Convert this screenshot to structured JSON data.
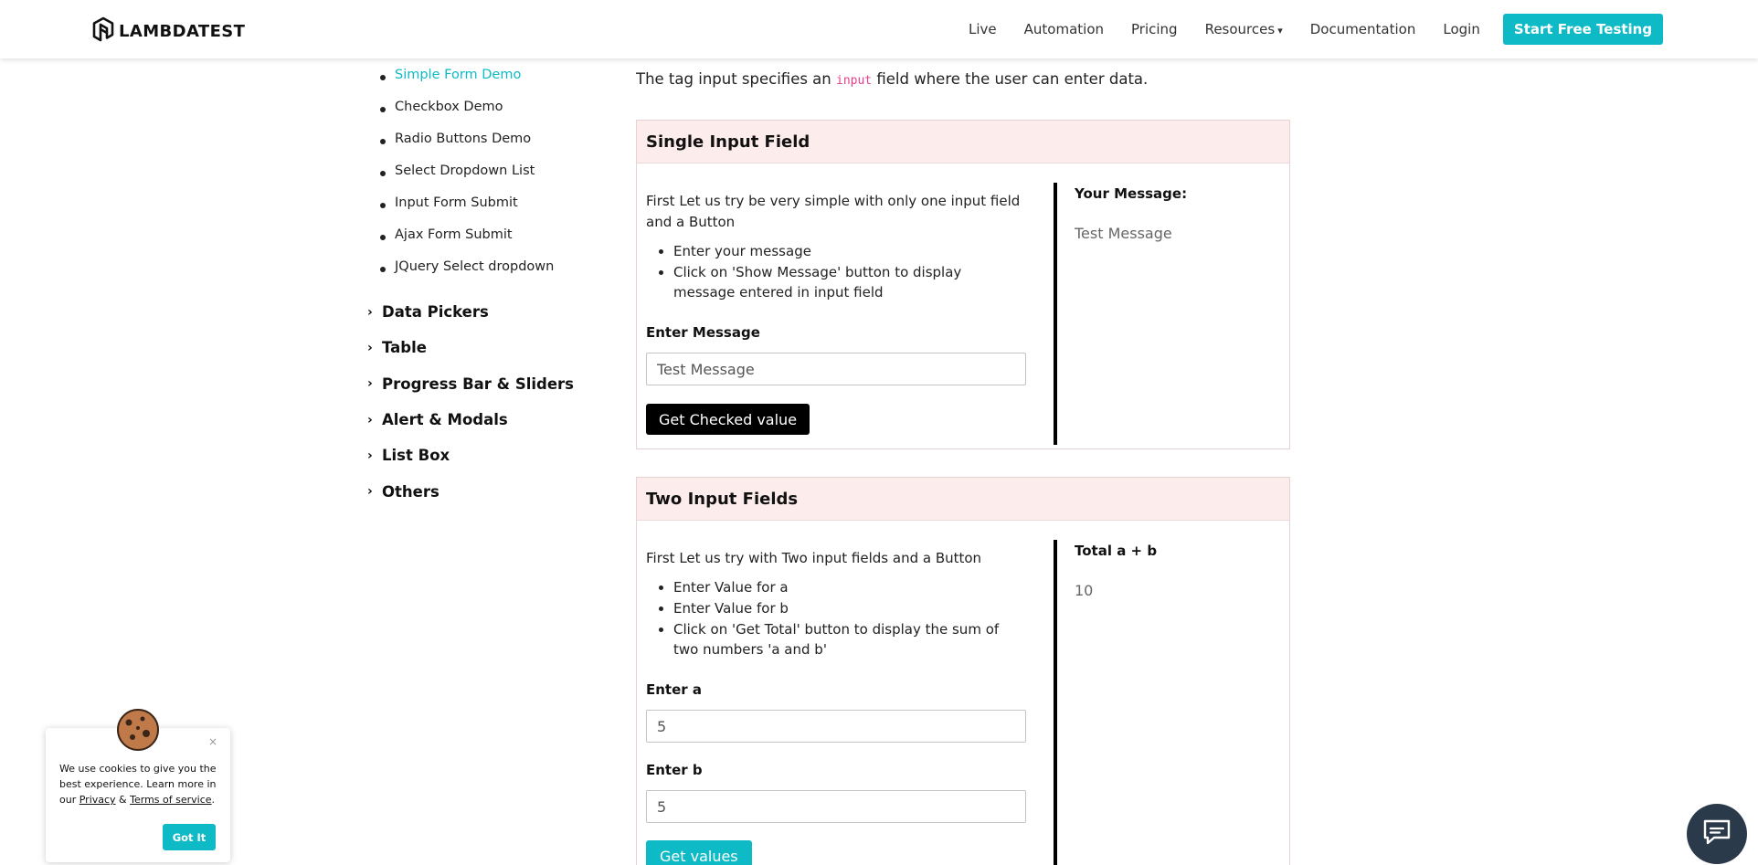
{
  "header": {
    "logo_text": "LAMBDATEST",
    "nav": [
      {
        "label": "Live"
      },
      {
        "label": "Automation"
      },
      {
        "label": "Pricing"
      },
      {
        "label": "Resources"
      },
      {
        "label": "Documentation"
      },
      {
        "label": "Login"
      }
    ],
    "cta_label": "Start Free Testing"
  },
  "sidebar": {
    "sub_items": [
      {
        "label": "Simple Form Demo",
        "active": true
      },
      {
        "label": "Checkbox Demo"
      },
      {
        "label": "Radio Buttons Demo"
      },
      {
        "label": "Select Dropdown List"
      },
      {
        "label": "Input Form Submit"
      },
      {
        "label": "Ajax Form Submit"
      },
      {
        "label": "JQuery Select dropdown"
      }
    ],
    "categories": [
      {
        "label": "Data Pickers"
      },
      {
        "label": "Table"
      },
      {
        "label": "Progress Bar & Sliders"
      },
      {
        "label": "Alert & Modals"
      },
      {
        "label": "List Box"
      },
      {
        "label": "Others"
      }
    ]
  },
  "main": {
    "intro_before": "The tag input specifies an ",
    "intro_code": "input",
    "intro_after": " field where the user can enter data.",
    "single": {
      "title": "Single Input Field",
      "desc": "First Let us try be very simple with only one input field and a Button",
      "bullets": [
        "Enter your message",
        "Click on 'Show Message' button to display message entered in input field"
      ],
      "field_label": "Enter Message",
      "input_value": "Test Message",
      "button_label": "Get Checked value",
      "result_title": "Your Message:",
      "result_value": "Test Message"
    },
    "two": {
      "title": "Two Input Fields",
      "desc": "First Let us try with Two input fields and a Button",
      "bullets": [
        "Enter Value for a",
        "Enter Value for b",
        "Click on 'Get Total' button to display the sum of two numbers 'a and b'"
      ],
      "label_a": "Enter a",
      "value_a": "5",
      "label_b": "Enter b",
      "value_b": "5",
      "button_label": "Get values",
      "result_title": "Total a + b",
      "result_value": "10"
    }
  },
  "cookie": {
    "close": "×",
    "text_before": "We use cookies to give you the best experience. Learn more in our ",
    "privacy": "Privacy",
    "amp": " & ",
    "terms": "Terms of service",
    "period": ".",
    "button_label": "Got It"
  },
  "colors": {
    "accent": "#0ebac5",
    "panel_header": "#fdecec",
    "code_pink": "#e83e8c"
  },
  "icons": {
    "logo": "lambdatest-logo-icon",
    "resources_caret": "chevron-down-icon",
    "category": "chevron-right-icon",
    "cookie": "cookie-icon",
    "chat": "chat-bubble-icon"
  }
}
